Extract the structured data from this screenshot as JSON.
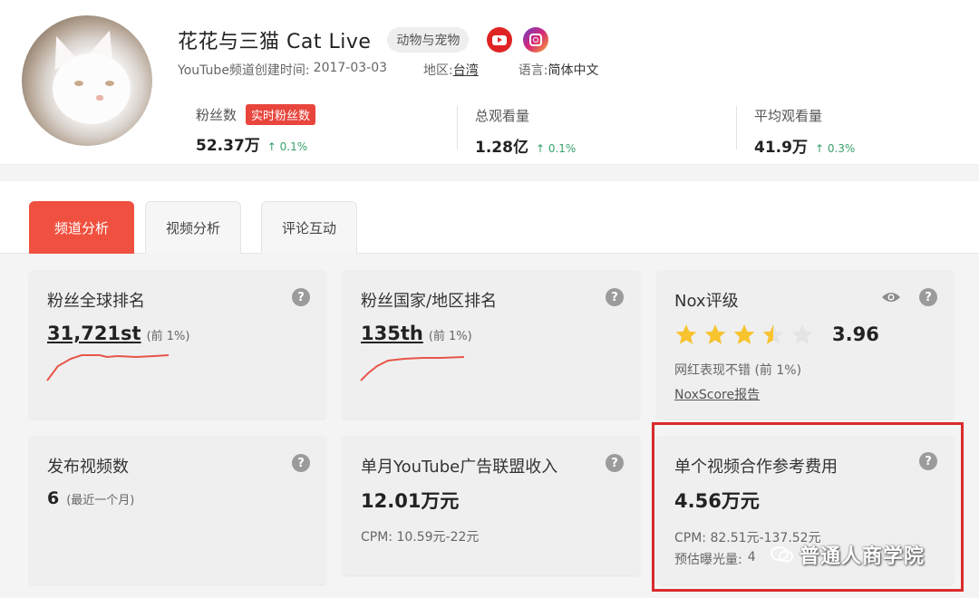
{
  "profile": {
    "channel_name": "花花与三猫 Cat Live",
    "category_tag": "动物与宠物",
    "created_label": "YouTube频道创建时间:",
    "created_date": "2017-03-03",
    "region_label": "地区:",
    "region_value": "台湾",
    "language_label": "语言:",
    "language_value": "简体中文",
    "icons": [
      "youtube-icon",
      "instagram-icon"
    ]
  },
  "stats": [
    {
      "label": "粉丝数",
      "badge": "实时粉丝数",
      "value": "52.37万",
      "change": "0.1%"
    },
    {
      "label": "总观看量",
      "value": "1.28亿",
      "change": "0.1%"
    },
    {
      "label": "平均观看量",
      "value": "41.9万",
      "change": "0.3%"
    }
  ],
  "tabs": [
    {
      "label": "频道分析",
      "active": true
    },
    {
      "label": "视频分析",
      "active": false
    },
    {
      "label": "评论互动",
      "active": false
    }
  ],
  "cards": {
    "global_rank": {
      "title": "粉丝全球排名",
      "value": "31,721st",
      "note": "(前 1%)"
    },
    "country_rank": {
      "title": "粉丝国家/地区排名",
      "value": "135th",
      "note": "(前 1%)"
    },
    "nox": {
      "title": "Nox评级",
      "score": "3.96",
      "stars_filled": 3.5,
      "stars_total": 5,
      "desc": "网红表现不错 (前 1%)",
      "link": "NoxScore报告"
    },
    "videos": {
      "title": "发布视频数",
      "value": "6",
      "note": "(最近一个月)"
    },
    "ad_income": {
      "title": "单月YouTube广告联盟收入",
      "value": "12.01万元",
      "cpm": "CPM: 10.59元-22元"
    },
    "collab_fee": {
      "title": "单个视频合作参考费用",
      "value": "4.56万元",
      "cpm": "CPM: 82.51元-137.52元",
      "exposure_label": "预估曝光量:",
      "exposure_value": "4"
    }
  },
  "help_symbol": "?",
  "watermark": "普通人商学院",
  "colors": {
    "accent": "#f0503f",
    "up": "#38a169",
    "star": "#f7c32e",
    "highlight": "#d92b2b"
  }
}
